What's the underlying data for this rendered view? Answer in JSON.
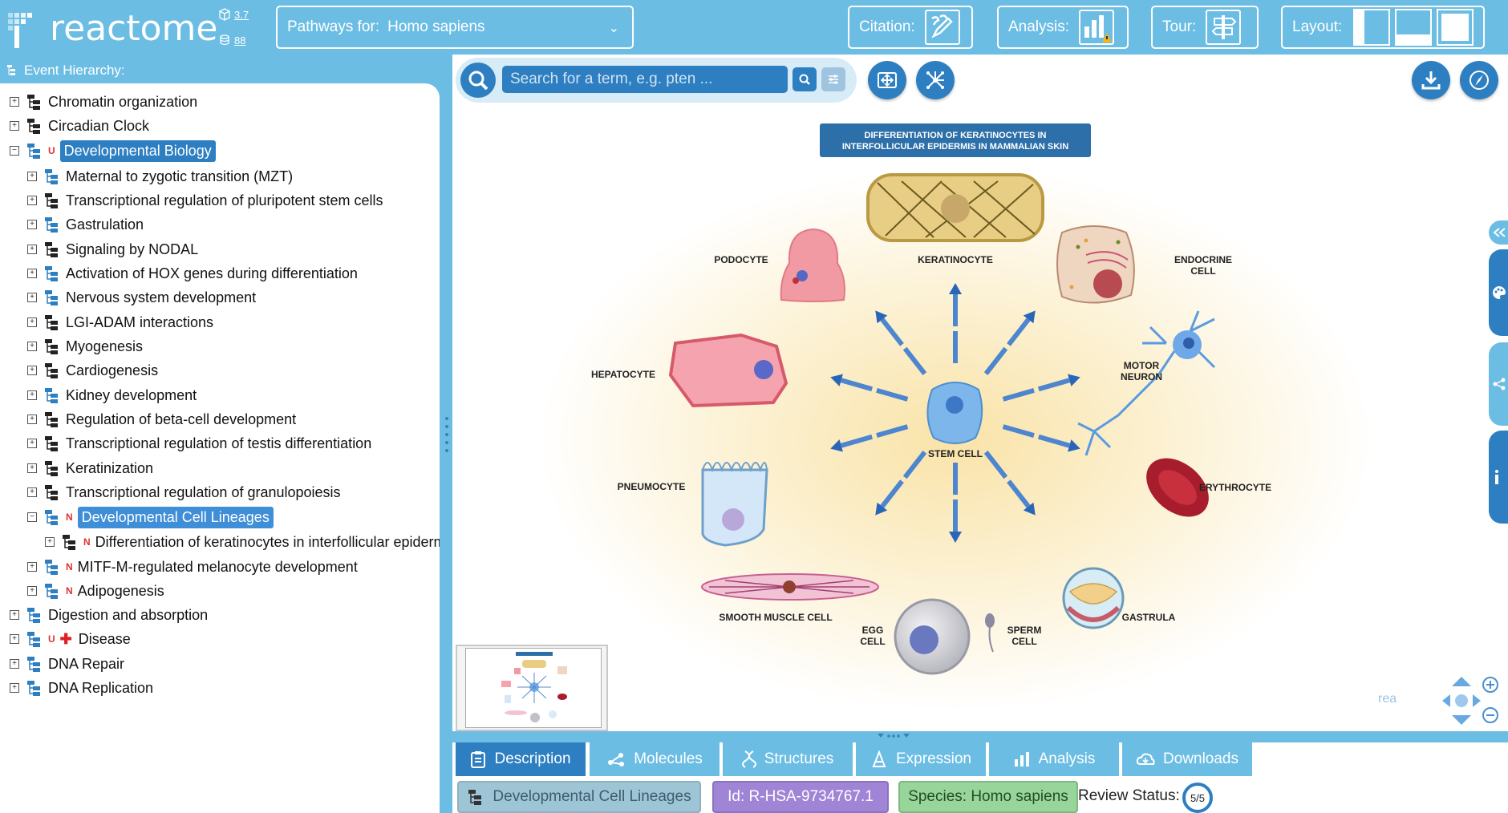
{
  "app": {
    "logo_text": "reactome",
    "version": "3.7",
    "release": "88"
  },
  "topbar": {
    "species_label": "Pathways for:",
    "species_value": "Homo sapiens",
    "citation_label": "Citation:",
    "analysis_label": "Analysis:",
    "tour_label": "Tour:",
    "layout_label": "Layout:"
  },
  "hierarchy": {
    "title": "Event Hierarchy:",
    "rows": [
      {
        "label": "Chromatin organization",
        "level": 0,
        "toggle": "+",
        "badge": "",
        "style": "normal"
      },
      {
        "label": "Circadian Clock",
        "level": 0,
        "toggle": "+",
        "badge": "",
        "style": "normal"
      },
      {
        "label": "Developmental Biology",
        "level": 0,
        "toggle": "−",
        "badge": "U",
        "style": "selected"
      },
      {
        "label": "Maternal to zygotic transition (MZT)",
        "level": 1,
        "toggle": "+",
        "badge": "",
        "style": "normal"
      },
      {
        "label": "Transcriptional regulation of pluripotent stem cells",
        "level": 1,
        "toggle": "+",
        "badge": "",
        "style": "normal"
      },
      {
        "label": "Gastrulation",
        "level": 1,
        "toggle": "+",
        "badge": "",
        "style": "normal"
      },
      {
        "label": "Signaling by NODAL",
        "level": 1,
        "toggle": "+",
        "badge": "",
        "style": "normal"
      },
      {
        "label": "Activation of HOX genes during differentiation",
        "level": 1,
        "toggle": "+",
        "badge": "",
        "style": "normal"
      },
      {
        "label": "Nervous system development",
        "level": 1,
        "toggle": "+",
        "badge": "",
        "style": "normal"
      },
      {
        "label": "LGI-ADAM interactions",
        "level": 1,
        "toggle": "+",
        "badge": "",
        "style": "normal"
      },
      {
        "label": "Myogenesis",
        "level": 1,
        "toggle": "+",
        "badge": "",
        "style": "normal"
      },
      {
        "label": "Cardiogenesis",
        "level": 1,
        "toggle": "+",
        "badge": "",
        "style": "normal"
      },
      {
        "label": "Kidney development",
        "level": 1,
        "toggle": "+",
        "badge": "",
        "style": "normal"
      },
      {
        "label": "Regulation of beta-cell development",
        "level": 1,
        "toggle": "+",
        "badge": "",
        "style": "normal"
      },
      {
        "label": "Transcriptional regulation of testis differentiation",
        "level": 1,
        "toggle": "+",
        "badge": "",
        "style": "normal"
      },
      {
        "label": "Keratinization",
        "level": 1,
        "toggle": "+",
        "badge": "",
        "style": "normal"
      },
      {
        "label": "Transcriptional regulation of granulopoiesis",
        "level": 1,
        "toggle": "+",
        "badge": "",
        "style": "normal"
      },
      {
        "label": "Developmental Cell Lineages",
        "level": 1,
        "toggle": "−",
        "badge": "N",
        "style": "selected2"
      },
      {
        "label": "Differentiation of keratinocytes in interfollicular epidermis in mammalian skin",
        "level": 2,
        "toggle": "+",
        "badge": "N",
        "style": "normal"
      },
      {
        "label": "MITF-M-regulated melanocyte development",
        "level": 1,
        "toggle": "+",
        "badge": "N",
        "style": "normal"
      },
      {
        "label": "Adipogenesis",
        "level": 1,
        "toggle": "+",
        "badge": "N",
        "style": "normal"
      },
      {
        "label": "Digestion and absorption",
        "level": 0,
        "toggle": "+",
        "badge": "",
        "style": "normal"
      },
      {
        "label": "Disease",
        "level": 0,
        "toggle": "+",
        "badge": "U",
        "style": "disease"
      },
      {
        "label": "DNA Repair",
        "level": 0,
        "toggle": "+",
        "badge": "",
        "style": "normal"
      },
      {
        "label": "DNA Replication",
        "level": 0,
        "toggle": "+",
        "badge": "",
        "style": "normal"
      }
    ]
  },
  "search": {
    "placeholder": "Search for a term, e.g. pten ..."
  },
  "diagram": {
    "title_line1": "DIFFERENTIATION OF KERATINOCYTES IN",
    "title_line2": "INTERFOLLICULAR EPIDERMIS IN MAMMALIAN SKIN",
    "center_label": "STEM CELL",
    "cells": {
      "keratinocyte": "KERATINOCYTE",
      "podocyte": "PODOCYTE",
      "endocrine_1": "ENDOCRINE",
      "endocrine_2": "CELL",
      "hepatocyte": "HEPATOCYTE",
      "motor_1": "MOTOR",
      "motor_2": "NEURON",
      "pneumocyte": "PNEUMOCYTE",
      "erythrocyte": "ERYTHROCYTE",
      "smooth_muscle": "SMOOTH MUSCLE CELL",
      "egg_1": "EGG",
      "egg_2": "CELL",
      "sperm_1": "SPERM",
      "sperm_2": "CELL",
      "gastrula": "GASTRULA"
    },
    "thumb_logo": "rea"
  },
  "bottom": {
    "tabs": [
      {
        "label": "Description",
        "icon": "clipboard-icon"
      },
      {
        "label": "Molecules",
        "icon": "molecule-icon"
      },
      {
        "label": "Structures",
        "icon": "dna-icon"
      },
      {
        "label": "Expression",
        "icon": "expression-icon"
      },
      {
        "label": "Analysis",
        "icon": "bar-chart-icon"
      },
      {
        "label": "Downloads",
        "icon": "cloud-download-icon"
      }
    ],
    "pathway_name": "Developmental Cell Lineages",
    "pathway_id": "Id: R-HSA-9734767.1",
    "species": "Species: Homo sapiens",
    "review_label": "Review Status:",
    "review_value": "5/5"
  },
  "colors": {
    "accent": "#2d7fc1",
    "panel": "#6cbde4"
  }
}
